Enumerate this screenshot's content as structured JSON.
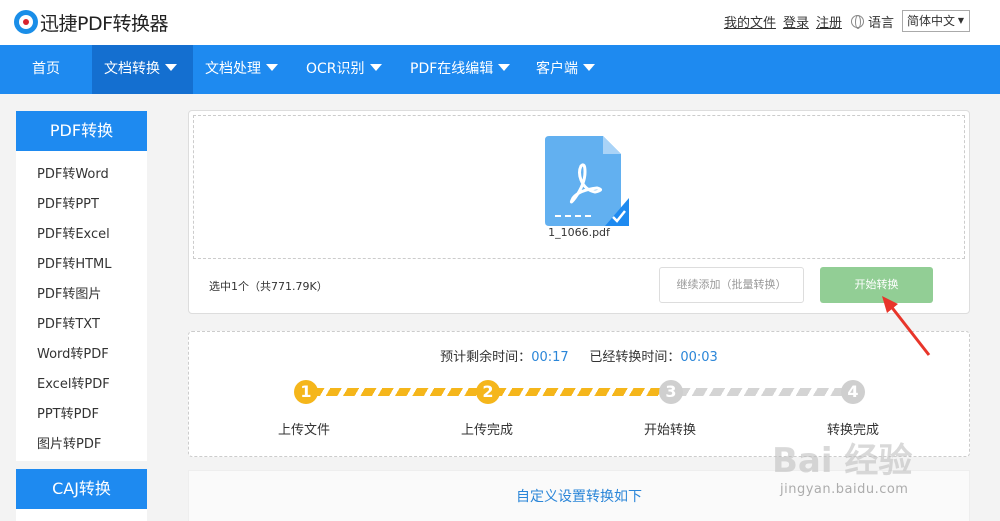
{
  "header": {
    "logo_text": "迅捷PDF转换器",
    "links": [
      "我的文件",
      "登录",
      "注册"
    ],
    "language_label": "语言",
    "language_select": "简体中文"
  },
  "nav": {
    "items": [
      {
        "label": "首页",
        "active": false,
        "dropdown": false
      },
      {
        "label": "文档转换",
        "active": true,
        "dropdown": true
      },
      {
        "label": "文档处理",
        "active": false,
        "dropdown": true
      },
      {
        "label": "OCR识别",
        "active": false,
        "dropdown": true
      },
      {
        "label": "PDF在线编辑",
        "active": false,
        "dropdown": true
      },
      {
        "label": "客户端",
        "active": false,
        "dropdown": true
      }
    ]
  },
  "sidebar": {
    "heading": "PDF转换",
    "items": [
      "PDF转Word",
      "PDF转PPT",
      "PDF转Excel",
      "PDF转HTML",
      "PDF转图片",
      "PDF转TXT",
      "Word转PDF",
      "Excel转PDF",
      "PPT转PDF",
      "图片转PDF"
    ],
    "heading2": "CAJ转换"
  },
  "upload": {
    "file_name": "1_1066.pdf",
    "selection_info": "选中1个（共771.79K）",
    "add_button": "继续添加（批量转换）",
    "start_button": "开始转换"
  },
  "progress": {
    "remaining_label": "预计剩余时间：",
    "remaining_value": "00:17",
    "elapsed_label": "已经转换时间：",
    "elapsed_value": "00:03",
    "steps": [
      {
        "num": "1",
        "label": "上传文件",
        "done": true
      },
      {
        "num": "2",
        "label": "上传完成",
        "done": true
      },
      {
        "num": "3",
        "label": "开始转换",
        "done": false
      },
      {
        "num": "4",
        "label": "转换完成",
        "done": false
      }
    ]
  },
  "settings": {
    "title": "自定义设置转换如下"
  },
  "watermark": {
    "brand": "Bai 经验",
    "url": "jingyan.baidu.com"
  },
  "colors": {
    "nav_blue": "#1e8af0",
    "nav_active": "#146fd0",
    "start_green": "#92ce95",
    "step_done": "#f5b61b",
    "step_todo": "#cfcfcf",
    "time_blue": "#2b86d8",
    "arrow_red": "#e8352a"
  }
}
